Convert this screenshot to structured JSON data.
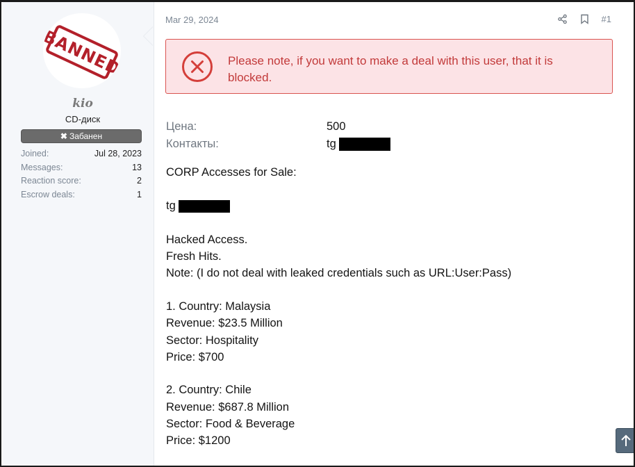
{
  "user": {
    "avatar_stamp": "BANNED",
    "name": "kio",
    "title": "CD-диск",
    "banner_label": "Забанен",
    "stats": [
      {
        "label": "Joined:",
        "value": "Jul 28, 2023"
      },
      {
        "label": "Messages:",
        "value": "13"
      },
      {
        "label": "Reaction score:",
        "value": "2"
      },
      {
        "label": "Escrow deals:",
        "value": "1"
      }
    ]
  },
  "post": {
    "date": "Mar 29, 2024",
    "number": "#1",
    "alert_text": "Please note, if you want to make a deal with this user, that it is blocked.",
    "price_label": "Цена:",
    "price_value": "500",
    "contacts_label": "Контакты:",
    "contacts_value": "tg",
    "lines": [
      "CORP Accesses for Sale:",
      "tg",
      "Hacked Access.",
      "Fresh Hits.",
      "Note: (I do not deal with leaked credentials such as URL:User:Pass)",
      "1. Country: Malaysia",
      "Revenue: $23.5 Million",
      "Sector: Hospitality",
      "Price: $700",
      "2. Country: Chile",
      "Revenue: $687.8 Million",
      "Sector: Food & Beverage",
      "Price: $1200"
    ]
  },
  "icons": {
    "share": "share-icon",
    "bookmark": "bookmark-icon",
    "alert": "error-circle-x-icon",
    "scroll_top": "arrow-up-icon"
  },
  "colors": {
    "alert_bg": "#fce3e6",
    "alert_border": "#d9534f",
    "alert_text": "#c23a3a",
    "banned_stamp": "#b3202a",
    "banner_bg": "#6b6b6b"
  }
}
